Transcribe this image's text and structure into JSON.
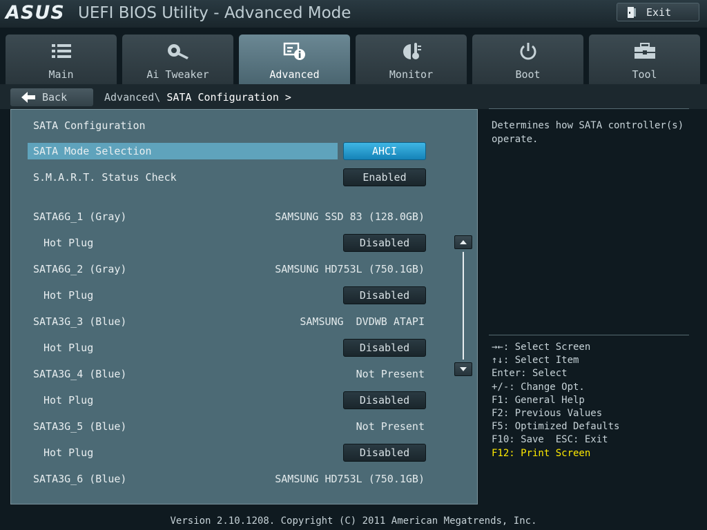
{
  "header": {
    "logo": "ASUS",
    "title": "UEFI BIOS Utility - Advanced Mode",
    "exit_label": "Exit"
  },
  "tabs": [
    {
      "label": "Main",
      "icon": "list-icon",
      "active": false
    },
    {
      "label": "Ai Tweaker",
      "icon": "tweaker-icon",
      "active": false
    },
    {
      "label": "Advanced",
      "icon": "advanced-info-icon",
      "active": true
    },
    {
      "label": "Monitor",
      "icon": "monitor-gauge-icon",
      "active": false
    },
    {
      "label": "Boot",
      "icon": "power-icon",
      "active": false
    },
    {
      "label": "Tool",
      "icon": "toolbox-icon",
      "active": false
    }
  ],
  "subbar": {
    "back_label": "Back",
    "breadcrumb_parent": "Advanced\\",
    "breadcrumb_current": "SATA Configuration >"
  },
  "main": {
    "section_title": "SATA Configuration",
    "sata_mode": {
      "label": "SATA Mode Selection",
      "value": "AHCI"
    },
    "smart": {
      "label": "S.M.A.R.T. Status Check",
      "value": "Enabled"
    },
    "ports": [
      {
        "label": "SATA6G_1 (Gray)",
        "device": "SAMSUNG SSD 83 (128.0GB)",
        "hot_plug_label": "Hot Plug",
        "hot_plug": "Disabled"
      },
      {
        "label": "SATA6G_2 (Gray)",
        "device": "SAMSUNG HD753L (750.1GB)",
        "hot_plug_label": "Hot Plug",
        "hot_plug": "Disabled"
      },
      {
        "label": "SATA3G_3 (Blue)",
        "device": "SAMSUNG  DVDWB ATAPI",
        "hot_plug_label": "Hot Plug",
        "hot_plug": "Disabled"
      },
      {
        "label": "SATA3G_4 (Blue)",
        "device": "Not Present",
        "hot_plug_label": "Hot Plug",
        "hot_plug": "Disabled"
      },
      {
        "label": "SATA3G_5 (Blue)",
        "device": "Not Present",
        "hot_plug_label": "Hot Plug",
        "hot_plug": "Disabled"
      },
      {
        "label": "SATA3G_6 (Blue)",
        "device": "SAMSUNG HD753L (750.1GB)"
      }
    ]
  },
  "help": {
    "description": "Determines how SATA controller(s) operate.",
    "keys": [
      "→←: Select Screen",
      "↑↓: Select Item",
      "Enter: Select",
      "+/-: Change Opt.",
      "F1: General Help",
      "F2: Previous Values",
      "F5: Optimized Defaults",
      "F10: Save  ESC: Exit",
      "F12: Print Screen"
    ]
  },
  "footer": {
    "text": "Version 2.10.1208. Copyright (C) 2011 American Megatrends, Inc."
  },
  "colors": {
    "accent": "#1583b8",
    "highlight": "#5fa3bc",
    "panel": "#4c6a75",
    "hotkey": "#ffea00"
  }
}
